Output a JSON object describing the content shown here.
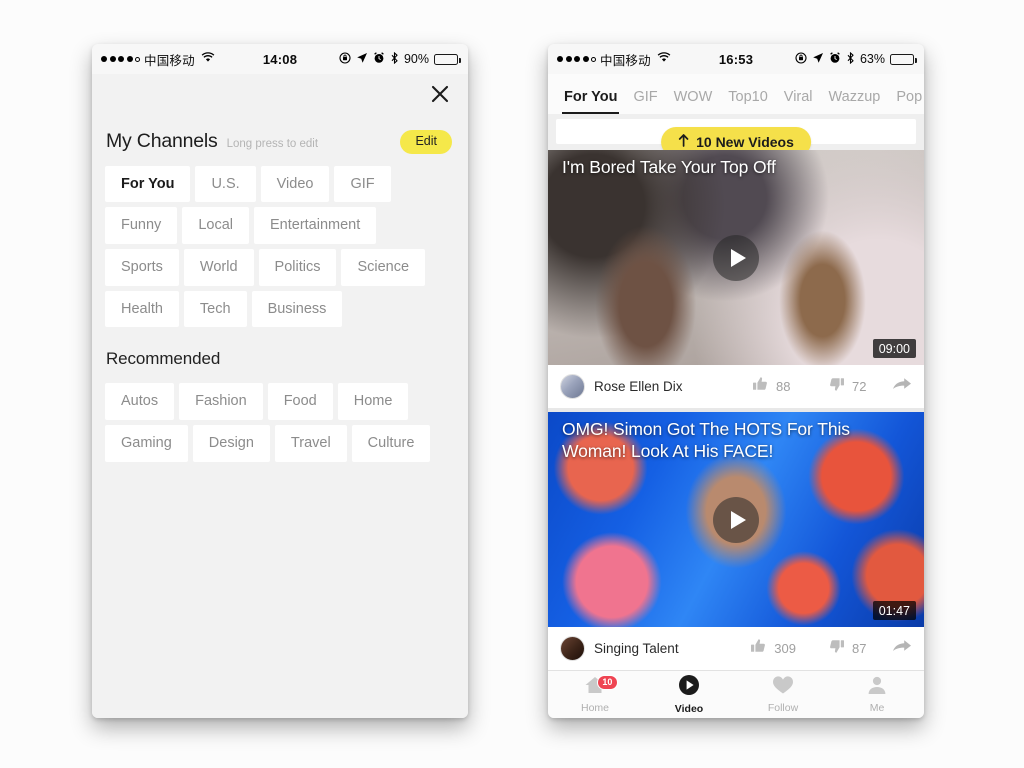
{
  "left_phone": {
    "status_bar": {
      "signal_icon": "signal-dots",
      "carrier": "中国移动",
      "wifi_icon": "wifi-icon",
      "time": "14:08",
      "rotation_lock_icon": "rotation-lock-icon",
      "location_icon": "location-arrow-icon",
      "alarm_icon": "alarm-clock-icon",
      "bluetooth_icon": "bluetooth-icon",
      "battery_text": "90%",
      "battery_icon": "battery-icon",
      "battery_level": 90
    },
    "close_icon": "close-icon",
    "my_channels": {
      "title": "My Channels",
      "hint": "Long press to edit",
      "edit_label": "Edit",
      "edit_color": "#f5e84a",
      "chips": [
        {
          "label": "For You",
          "active": true
        },
        {
          "label": "U.S.",
          "active": false
        },
        {
          "label": "Video",
          "active": false
        },
        {
          "label": "GIF",
          "active": false
        },
        {
          "label": "Funny",
          "active": false
        },
        {
          "label": "Local",
          "active": false
        },
        {
          "label": "Entertainment",
          "active": false
        },
        {
          "label": "Sports",
          "active": false
        },
        {
          "label": "World",
          "active": false
        },
        {
          "label": "Politics",
          "active": false
        },
        {
          "label": "Science",
          "active": false
        },
        {
          "label": "Health",
          "active": false
        },
        {
          "label": "Tech",
          "active": false
        },
        {
          "label": "Business",
          "active": false
        }
      ]
    },
    "recommended": {
      "title": "Recommended",
      "chips": [
        {
          "label": "Autos"
        },
        {
          "label": "Fashion"
        },
        {
          "label": "Food"
        },
        {
          "label": "Home"
        },
        {
          "label": "Gaming"
        },
        {
          "label": "Design"
        },
        {
          "label": "Travel"
        },
        {
          "label": "Culture"
        }
      ]
    }
  },
  "right_phone": {
    "status_bar": {
      "signal_icon": "signal-dots",
      "carrier": "中国移动",
      "wifi_icon": "wifi-icon",
      "time": "16:53",
      "rotation_lock_icon": "rotation-lock-icon",
      "location_icon": "location-arrow-icon",
      "alarm_icon": "alarm-clock-icon",
      "bluetooth_icon": "bluetooth-icon",
      "battery_text": "63%",
      "battery_icon": "battery-icon",
      "battery_level": 63
    },
    "tabs": [
      {
        "label": "For You",
        "active": true
      },
      {
        "label": "GIF",
        "active": false
      },
      {
        "label": "WOW",
        "active": false
      },
      {
        "label": "Top10",
        "active": false
      },
      {
        "label": "Viral",
        "active": false
      },
      {
        "label": "Wazzup",
        "active": false
      },
      {
        "label": "Pop",
        "active": false
      }
    ],
    "new_videos_pill": {
      "arrow_icon": "arrow-up-icon",
      "label": "10 New Videos",
      "color": "#f5e04a"
    },
    "cards": [
      {
        "title": "I'm Bored Take Your Top Off",
        "duration": "09:00",
        "play_icon": "play-icon",
        "avatar_icon": "avatar",
        "username": "Rose Ellen Dix",
        "like_icon": "thumbs-up-icon",
        "likes": "88",
        "dislike_icon": "thumbs-down-icon",
        "dislikes": "72",
        "share_icon": "share-icon"
      },
      {
        "title": "OMG! Simon Got The HOTS For This Woman! Look At His FACE!",
        "duration": "01:47",
        "play_icon": "play-icon",
        "avatar_icon": "avatar",
        "username": "Singing Talent",
        "like_icon": "thumbs-up-icon",
        "likes": "309",
        "dislike_icon": "thumbs-down-icon",
        "dislikes": "87",
        "share_icon": "share-icon"
      }
    ],
    "bottom_nav": [
      {
        "label": "Home",
        "icon": "home-icon",
        "active": false,
        "badge": "10"
      },
      {
        "label": "Video",
        "icon": "video-play-icon",
        "active": true,
        "badge": ""
      },
      {
        "label": "Follow",
        "icon": "heart-icon",
        "active": false,
        "badge": ""
      },
      {
        "label": "Me",
        "icon": "person-icon",
        "active": false,
        "badge": ""
      }
    ],
    "badge_color": "#ef4452"
  }
}
